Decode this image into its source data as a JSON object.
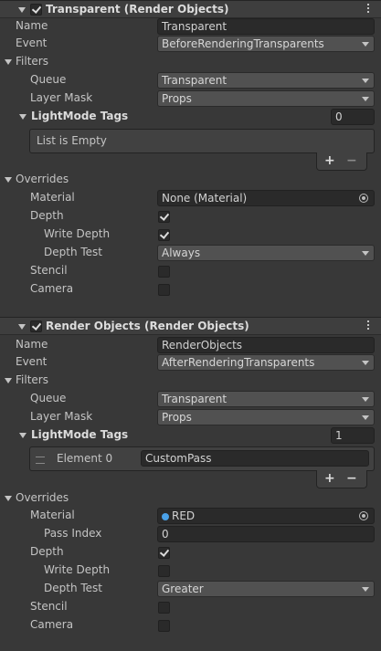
{
  "feature1": {
    "title": "Transparent (Render Objects)",
    "name_label": "Name",
    "name_value": "Transparent",
    "event_label": "Event",
    "event_value": "BeforeRenderingTransparents",
    "filters_label": "Filters",
    "queue_label": "Queue",
    "queue_value": "Transparent",
    "layer_label": "Layer Mask",
    "layer_value": "Props",
    "tags_label": "LightMode Tags",
    "tags_count": "0",
    "empty_text": "List is Empty",
    "overrides_label": "Overrides",
    "material_label": "Material",
    "material_value": "None (Material)",
    "depth_label": "Depth",
    "write_depth_label": "Write Depth",
    "depth_test_label": "Depth Test",
    "depth_test_value": "Always",
    "stencil_label": "Stencil",
    "camera_label": "Camera"
  },
  "feature2": {
    "title": "Render Objects (Render Objects)",
    "name_label": "Name",
    "name_value": "RenderObjects",
    "event_label": "Event",
    "event_value": "AfterRenderingTransparents",
    "filters_label": "Filters",
    "queue_label": "Queue",
    "queue_value": "Transparent",
    "layer_label": "Layer Mask",
    "layer_value": "Props",
    "tags_label": "LightMode Tags",
    "tags_count": "1",
    "element_label": "Element 0",
    "element_value": "CustomPass",
    "overrides_label": "Overrides",
    "material_label": "Material",
    "material_value": "RED",
    "pass_index_label": "Pass Index",
    "pass_index_value": "0",
    "depth_label": "Depth",
    "write_depth_label": "Write Depth",
    "depth_test_label": "Depth Test",
    "depth_test_value": "Greater",
    "stencil_label": "Stencil",
    "camera_label": "Camera"
  },
  "list_buttons": {
    "plus": "+",
    "minus": "−"
  },
  "checkbox_state": {
    "f1_enabled": true,
    "f1_depth": true,
    "f1_write_depth": true,
    "f1_stencil": false,
    "f1_camera": false,
    "f2_enabled": true,
    "f2_depth": true,
    "f2_write_depth": false,
    "f2_stencil": false,
    "f2_camera": false
  },
  "colors": {
    "background": "#383838",
    "field": "#2a2a2a",
    "popup": "#515151",
    "material_icon": "#4aa1e8"
  }
}
